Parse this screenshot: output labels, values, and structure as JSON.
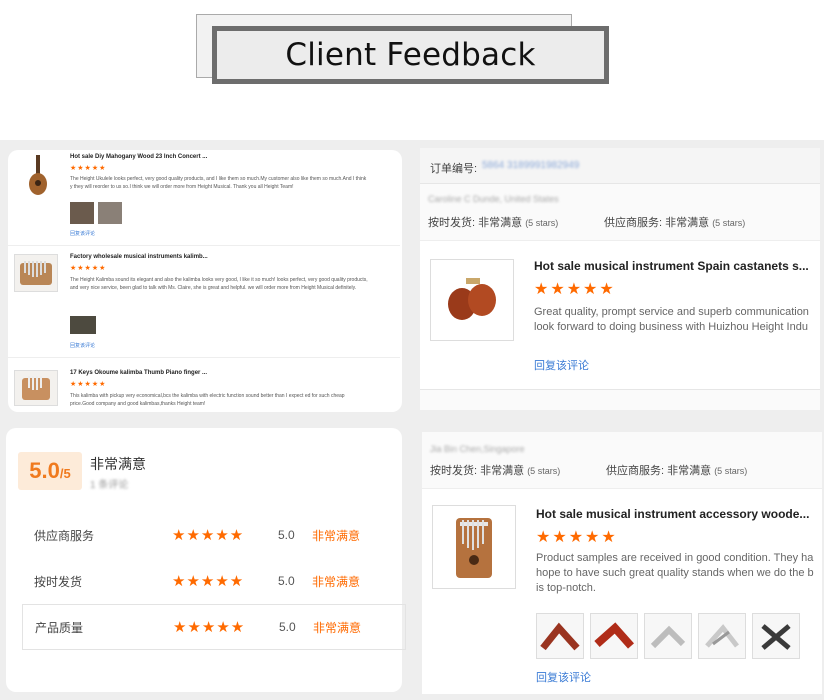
{
  "header": {
    "title": "Client Feedback"
  },
  "reviews_left": [
    {
      "title": "Hot sale Diy Mahogany Wood 23 Inch Concert ...",
      "stars": "★★★★★",
      "text": "The Height Ukulele looks perfect, very good quality products, and I like them so much.My customer also like them so much.And I think y they will reorder to us so.I think we will order more from Height Musical. Thank you all Height Team!",
      "link": "回复该评论"
    },
    {
      "title": "Factory wholesale musical instruments kalimb...",
      "stars": "★★★★★",
      "text": "The Height Kalimba sound its elegant and also the kalimba looks very good, I like it so much! looks perfect, very good quality products, and very nice service, been glad to talk with Ms. Claire, she is great and helpful. we will order more from Height Musical definitely.",
      "link": "回复该评论"
    },
    {
      "title": "17 Keys Okoume kalimba Thumb Piano finger ...",
      "stars": "★★★★★",
      "text": "This kalimba with pickup very economical,bcs the kalimba with electric function sound better than I expect ed for such cheap price.Good company and good kalimbas,thanks Height team!"
    }
  ],
  "rating_summary": {
    "score": "5.0",
    "score_suffix": "/5",
    "label": "非常满意",
    "sublabel": "1 条评论",
    "rows": [
      {
        "name": "供应商服务",
        "stars": "★★★★★",
        "value": "5.0",
        "verdict": "非常满意"
      },
      {
        "name": "按时发货",
        "stars": "★★★★★",
        "value": "5.0",
        "verdict": "非常满意"
      },
      {
        "name": "产品质量",
        "stars": "★★★★★",
        "value": "5.0",
        "verdict": "非常满意"
      }
    ]
  },
  "order_card": {
    "order_label": "订单编号:",
    "order_number": "5864 3189991982949",
    "buyer": "Caroline C Dunde, United States",
    "delivery_label": "按时发货:",
    "delivery_value": "非常满意",
    "delivery_stars": "(5 stars)",
    "service_label": "供应商服务:",
    "service_value": "非常满意",
    "service_stars": "(5 stars)",
    "product_title": "Hot sale musical instrument Spain castanets s...",
    "stars": "★★★★★",
    "review_lines": [
      "Great quality, prompt service and superb communication",
      "look forward to doing business with Huizhou Height Indu"
    ],
    "link": "回复该评论"
  },
  "second_card": {
    "buyer": "Jia Bin Chen,Singapore",
    "delivery_label": "按时发货:",
    "delivery_value": "非常满意",
    "delivery_stars": "(5 stars)",
    "service_label": "供应商服务:",
    "service_value": "非常满意",
    "service_stars": "(5 stars)",
    "product_title": "Hot sale musical instrument accessory woode...",
    "stars": "★★★★★",
    "review_lines": [
      "Product samples are received in good condition. They ha",
      "hope to have such great quality stands when we do the b",
      "is top-notch."
    ],
    "link": "回复该评论"
  },
  "colors": {
    "accent": "#ff6a00",
    "link": "#3a7bd5",
    "background": "#eeeeee"
  },
  "icons": [
    "ukulele-icon",
    "kalimba-icon",
    "castanets-icon",
    "stand-icon"
  ]
}
